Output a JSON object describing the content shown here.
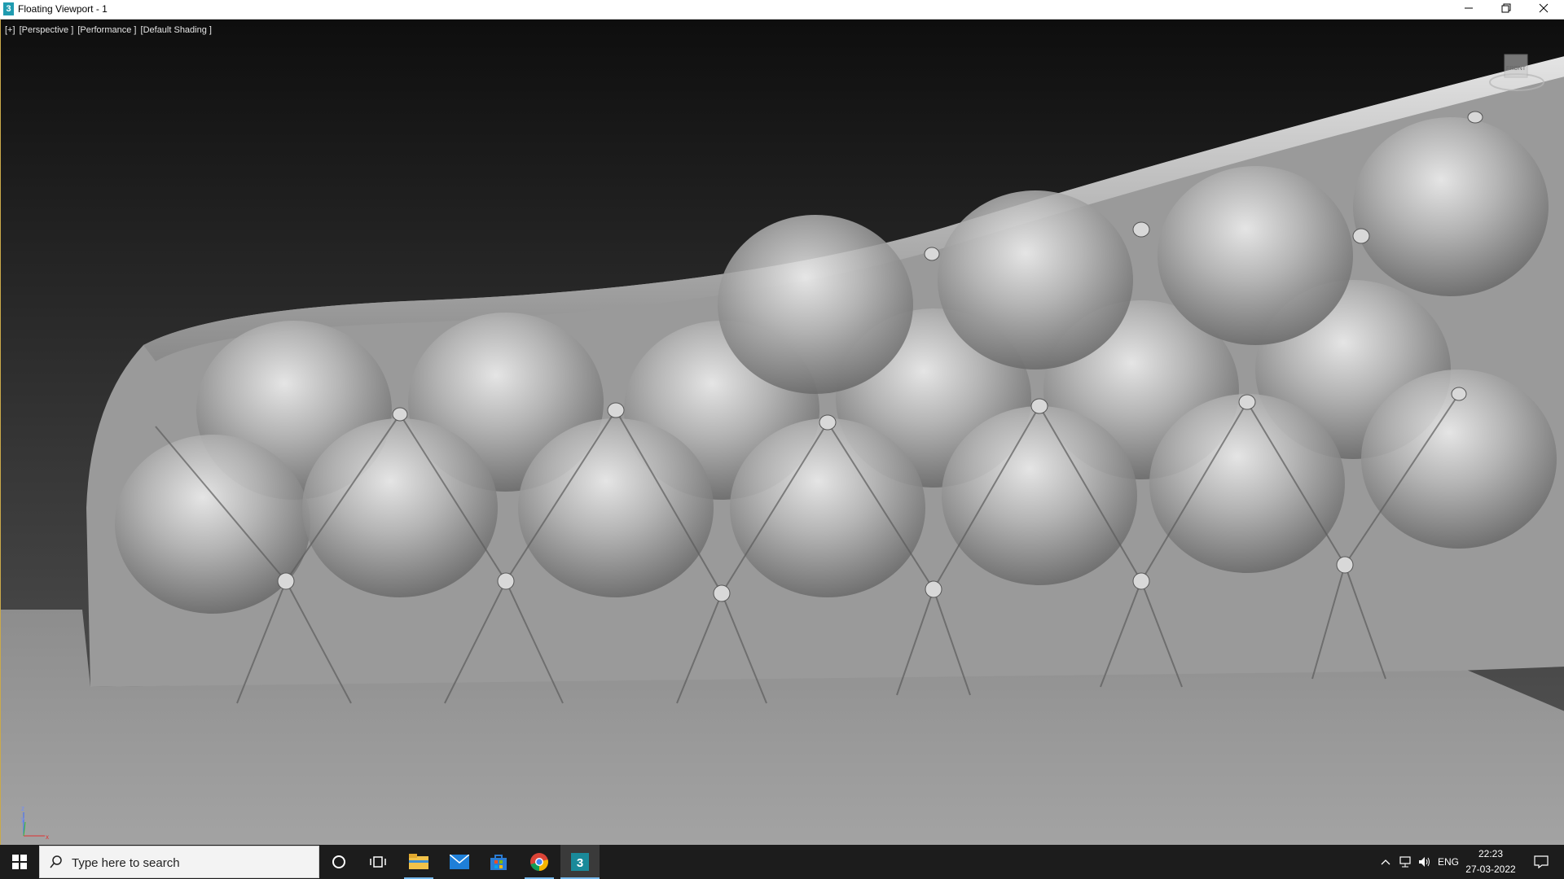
{
  "window": {
    "title": "Floating Viewport - 1",
    "app_icon_glyph": "3",
    "minimize_icon": "minimize-icon",
    "restore_icon": "restore-icon",
    "close_icon": "close-icon"
  },
  "viewport": {
    "labels": [
      "[+]",
      "[Perspective ]",
      "[Performance ]",
      "[Default Shading ]"
    ],
    "viewcube_label": "FRONT",
    "axis": {
      "z": "z",
      "y": "y",
      "x": "x"
    },
    "colors": {
      "background_top": "#0e0e0e",
      "background_bottom": "#5a5a5a",
      "surface": "#9b9b9b",
      "border_accent": "#caa94a"
    }
  },
  "taskbar": {
    "search_placeholder": "Type here to search",
    "apps": [
      "start-icon",
      "search-icon",
      "cortana-icon",
      "task-view-icon",
      "file-explorer-icon",
      "mail-icon",
      "store-icon",
      "chrome-icon",
      "3dsmax-icon"
    ],
    "tray": {
      "language": "ENG",
      "time": "22:23",
      "date": "27-03-2022"
    }
  }
}
